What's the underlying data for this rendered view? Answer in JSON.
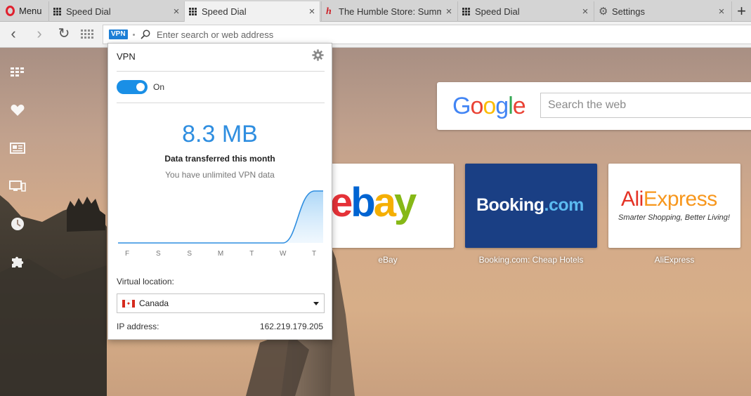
{
  "tabs": {
    "menu_label": "Menu",
    "items": [
      {
        "title": "Speed Dial",
        "icon": "speed-dial-icon",
        "active": false
      },
      {
        "title": "Speed Dial",
        "icon": "speed-dial-icon",
        "active": true
      },
      {
        "title": "The Humble Store: Summe",
        "icon": "humble-bundle-icon",
        "active": false
      },
      {
        "title": "Speed Dial",
        "icon": "speed-dial-icon",
        "active": false
      },
      {
        "title": "Settings",
        "icon": "gear-icon",
        "active": false
      }
    ],
    "close_glyph": "×",
    "new_tab_glyph": "+"
  },
  "toolbar": {
    "vpn_badge": "VPN",
    "address_placeholder": "Enter search or web address",
    "back_glyph": "‹",
    "forward_glyph": "›",
    "reload_glyph": "↻"
  },
  "sidebar": {
    "icons": [
      "speed-dial-icon",
      "heart-icon",
      "news-icon",
      "devices-icon",
      "history-icon",
      "extensions-icon"
    ]
  },
  "google": {
    "logo": [
      "G",
      "o",
      "o",
      "g",
      "l",
      "e"
    ],
    "search_placeholder": "Search the web"
  },
  "speed_dial": [
    {
      "caption": "eBay",
      "logo": [
        "e",
        "b",
        "a",
        "y"
      ]
    },
    {
      "caption": "Booking.com: Cheap Hotels",
      "logo_main": "Booking",
      "logo_suffix": ".com"
    },
    {
      "caption": "AliExpress",
      "logo_main": "Ali",
      "logo_suffix": "Express",
      "tagline": "Smarter Shopping, Better Living!"
    }
  ],
  "vpn_popup": {
    "title": "VPN",
    "toggle_label": "On",
    "toggle_on": true,
    "data_amount": "8.3 MB",
    "data_caption": "Data transferred this month",
    "data_subcaption": "You have unlimited VPN data",
    "location_label": "Virtual location:",
    "location_value": "Canada",
    "ip_label": "IP address:",
    "ip_value": "162.219.179.205"
  },
  "chart_data": {
    "type": "area",
    "categories": [
      "F",
      "S",
      "S",
      "M",
      "T",
      "W",
      "T"
    ],
    "values": [
      0,
      0,
      0,
      0,
      0,
      0,
      8.3
    ],
    "ylim": [
      0,
      8.3
    ],
    "grid": false
  },
  "colors": {
    "accent": "#2f8ee0",
    "toggle": "#1a8fe6",
    "opera_red": "#e0212e",
    "booking_blue": "#1a3f84",
    "ebay_red": "#e53238",
    "ebay_blue": "#0064d2",
    "ebay_yellow": "#f5af02",
    "ebay_green": "#86b817"
  }
}
